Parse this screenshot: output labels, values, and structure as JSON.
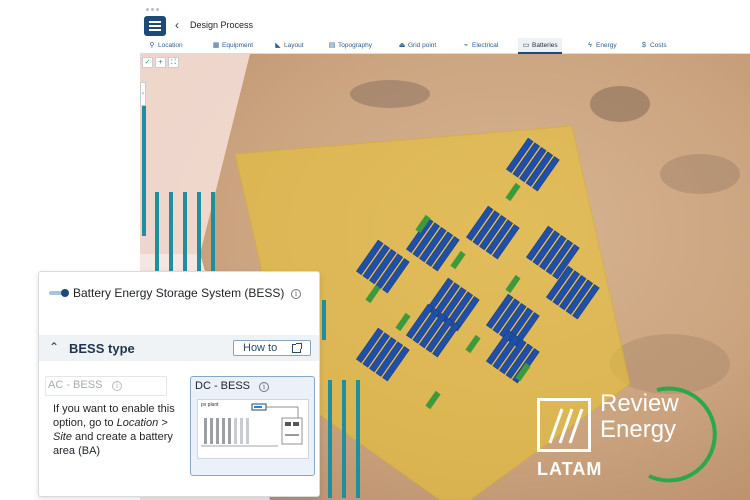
{
  "app": {
    "title": "Design Process",
    "back_icon": "chevron-left-icon",
    "menu_icon": "hamburger-menu-icon"
  },
  "tabs": [
    {
      "label": "Location",
      "icon": "pin-icon",
      "glyph": "⚲"
    },
    {
      "label": "Equipment",
      "icon": "grid-icon",
      "glyph": "▦"
    },
    {
      "label": "Layout",
      "icon": "layout-icon",
      "glyph": "◣"
    },
    {
      "label": "Topography",
      "icon": "topography-icon",
      "glyph": "▤"
    },
    {
      "label": "Grid point",
      "icon": "tower-icon",
      "glyph": "⏏"
    },
    {
      "label": "Electrical",
      "icon": "plug-icon",
      "glyph": "⌁"
    },
    {
      "label": "Batteries",
      "icon": "battery-icon",
      "glyph": "▭"
    },
    {
      "label": "Energy",
      "icon": "bolt-icon",
      "glyph": "ϟ"
    },
    {
      "label": "Costs",
      "icon": "dollar-icon",
      "glyph": "$"
    }
  ],
  "active_tab": "Batteries",
  "map_tools": {
    "check": "✓",
    "plus": "+",
    "expand": "⛶",
    "collapse": "‹"
  },
  "panel": {
    "bess_system_label": "Battery Energy Storage System (BESS)",
    "bess_enabled": true,
    "bess_type_title": "BESS type",
    "how_to_label": "How to",
    "info_glyph": "i",
    "options": {
      "ac": {
        "label": "AC - BESS",
        "enabled": false,
        "message_part1": "If you want to enable this option, go to ",
        "message_link": "Location > Site",
        "message_part2": " and create a battery area (BA)"
      },
      "dc": {
        "label": "DC - BESS",
        "selected": true,
        "diagram_label": "pv plant"
      }
    }
  },
  "watermark": {
    "line1": "Review",
    "line2": "Energy",
    "line3": "LATAM"
  },
  "colors": {
    "brand": "#1e4a7a",
    "battery_area": "#e8c23a",
    "panels": "#1f4fa8",
    "batteries": "#3c9a3c",
    "logo_ring": "#2aa84a"
  }
}
